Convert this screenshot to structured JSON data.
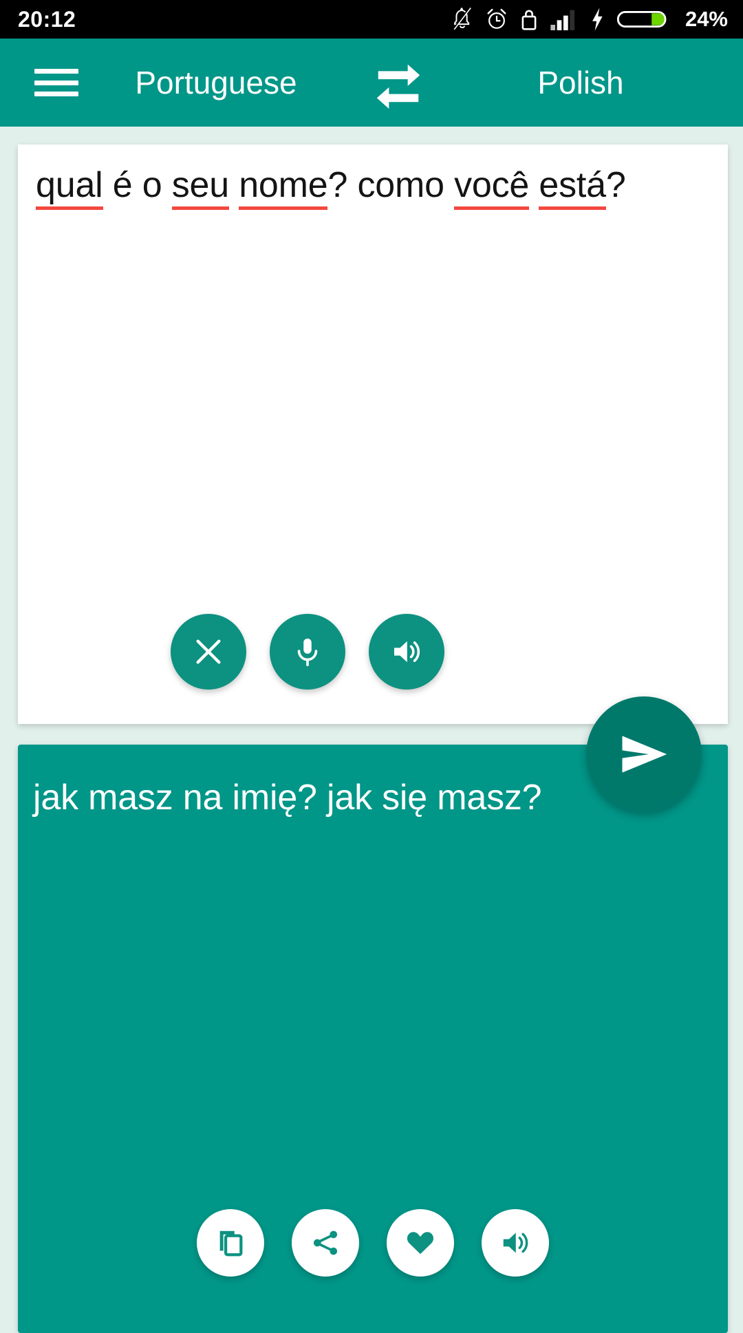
{
  "status_bar": {
    "time": "20:12",
    "battery_percent": "24%",
    "icons": [
      "bell-off-icon",
      "alarm-clock-icon",
      "lock-icon",
      "signal-bars-icon",
      "charging-bolt-icon",
      "battery-icon"
    ]
  },
  "app_bar": {
    "menu_label": "menu",
    "source_language": "Portuguese",
    "target_language": "Polish",
    "swap_icon": "swap-languages-icon"
  },
  "source": {
    "text": "qual é o seu nome? como você está?",
    "segments": [
      {
        "t": "qual",
        "misspelled": true
      },
      {
        "t": " é o ",
        "misspelled": false
      },
      {
        "t": "seu",
        "misspelled": true
      },
      {
        "t": " ",
        "misspelled": false
      },
      {
        "t": "nome",
        "misspelled": true
      },
      {
        "t": "? como ",
        "misspelled": false
      },
      {
        "t": "você",
        "misspelled": true
      },
      {
        "t": " ",
        "misspelled": false
      },
      {
        "t": "está",
        "misspelled": true
      },
      {
        "t": "?",
        "misspelled": false
      }
    ],
    "buttons": [
      {
        "name": "clear-button",
        "icon": "close-icon"
      },
      {
        "name": "microphone-button",
        "icon": "microphone-icon"
      },
      {
        "name": "speak-source-button",
        "icon": "speaker-icon"
      }
    ]
  },
  "translate_button": {
    "icon": "send-icon",
    "label": "Translate"
  },
  "target": {
    "text": "jak masz na imię? jak się masz?",
    "buttons": [
      {
        "name": "copy-button",
        "icon": "copy-icon"
      },
      {
        "name": "share-button",
        "icon": "share-icon"
      },
      {
        "name": "favorite-button",
        "icon": "heart-icon"
      },
      {
        "name": "speak-target-button",
        "icon": "speaker-icon"
      }
    ]
  },
  "colors": {
    "primary": "#009688",
    "primary_dark": "#00796b",
    "button_teal": "#0d9181",
    "background": "#e2f0ec",
    "spellcheck_red": "#f4483f",
    "battery_green": "#6dd400"
  }
}
